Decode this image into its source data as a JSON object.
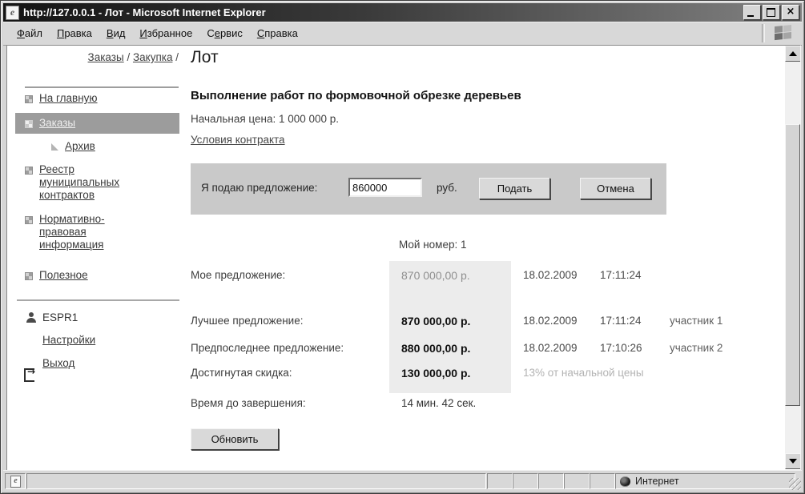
{
  "window": {
    "title": "http://127.0.0.1 - Лот - Microsoft Internet Explorer"
  },
  "menu": {
    "items": [
      {
        "pre": "",
        "accel": "Ф",
        "post": "айл"
      },
      {
        "pre": "",
        "accel": "П",
        "post": "равка"
      },
      {
        "pre": "",
        "accel": "В",
        "post": "ид"
      },
      {
        "pre": "",
        "accel": "И",
        "post": "збранное"
      },
      {
        "pre": "С",
        "accel": "е",
        "post": "рвис"
      },
      {
        "pre": "",
        "accel": "С",
        "post": "правка"
      }
    ]
  },
  "breadcrumb": {
    "link1": "Заказы",
    "sep1": "/",
    "link2": "Закупка",
    "sep2": "/",
    "title": "Лот"
  },
  "sidebar": {
    "items": [
      {
        "label": "На главную"
      },
      {
        "label": "Заказы",
        "selected": true
      },
      {
        "label": "Архив",
        "child": true
      },
      {
        "label": "Реестр муниципальных контрактов"
      },
      {
        "label": "Нормативно-правовая информация"
      },
      {
        "label": "Полезное"
      }
    ],
    "user": {
      "name": "ESPR1",
      "settings": "Настройки",
      "logout": "Выход"
    }
  },
  "main": {
    "lot_title": "Выполнение работ по формовочной обрезке деревьев",
    "start_price": "Начальная цена: 1 000 000 р.",
    "contract_link": "Условия контракта",
    "bid_form": {
      "label": "Я подаю предложение:",
      "value": "860000",
      "currency": "руб.",
      "submit": "Подать",
      "cancel": "Отмена"
    },
    "my_number": "Мой номер: 1",
    "rows": [
      {
        "label": "Мое предложение:",
        "value": "870 000,00 р.",
        "date": "18.02.2009",
        "time": "17:11:24"
      },
      {
        "label": "Лучшее предложение:",
        "value": "870 000,00 р.",
        "date": "18.02.2009",
        "time": "17:11:24",
        "note": "участник 1"
      },
      {
        "label": "Предпоследнее предложение:",
        "value": "880 000,00 р.",
        "date": "18.02.2009",
        "time": "17:10:26",
        "note": "участник 2"
      },
      {
        "label": "Достигнутая скидка:",
        "value": "130 000,00 р.",
        "note": "13% от начальной цены"
      },
      {
        "label": "Время до завершения:",
        "value": "14 мин. 42 сек."
      }
    ],
    "refresh_button": "Обновить"
  },
  "status_bar": {
    "zone": "Интернет"
  },
  "colors": {
    "selected_item_bg": "#9c9c9c",
    "form_bg": "#c9c9c9",
    "value_band_bg": "#ececec",
    "titlebar_gradient": [
      "#141414",
      "#828282"
    ]
  }
}
